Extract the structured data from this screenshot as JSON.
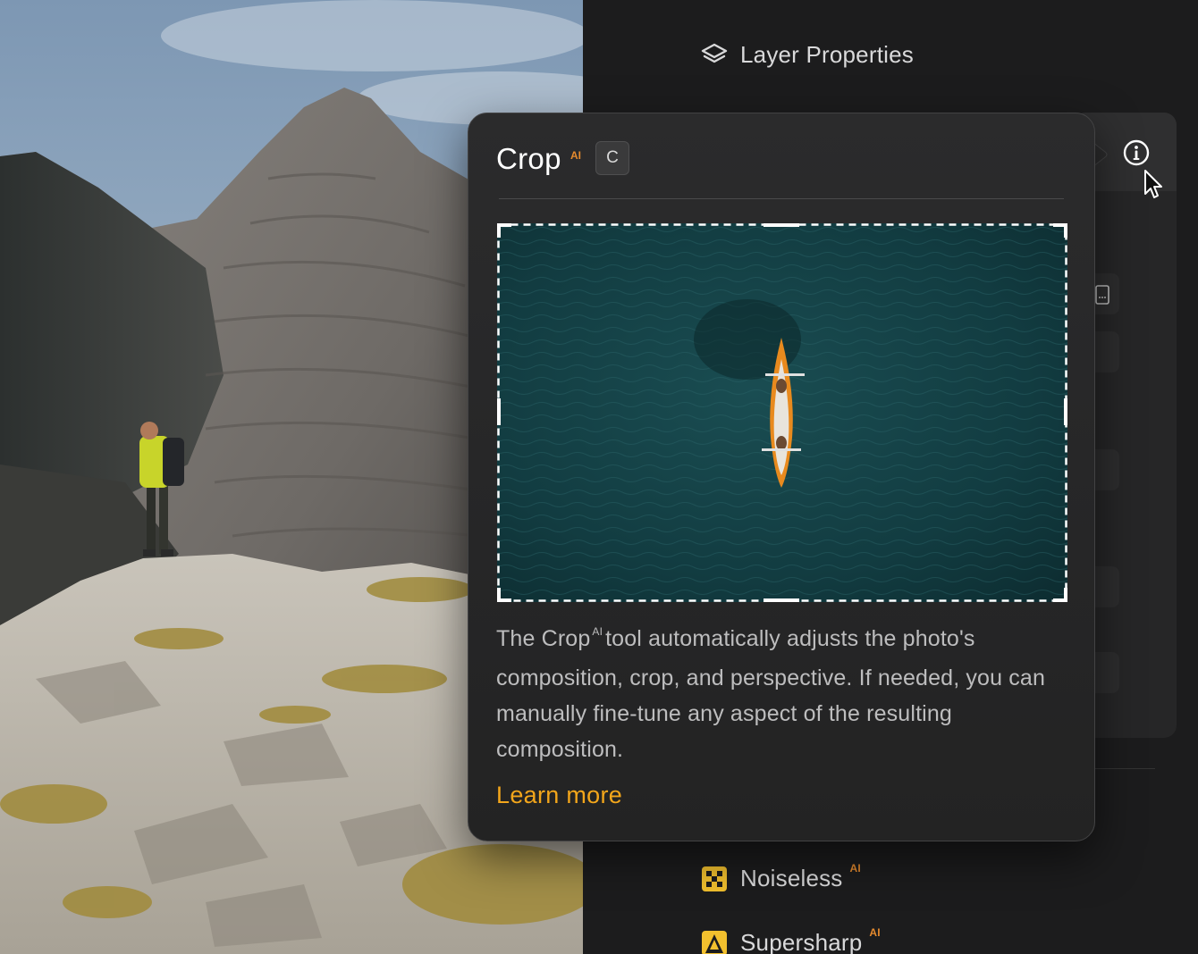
{
  "panel": {
    "layer_properties": {
      "label": "Layer Properties",
      "icon": "layers-icon"
    },
    "tools": [
      {
        "label": "Noiseless",
        "ai_badge": "AI",
        "icon": "noiseless-icon",
        "icon_color": "#f2c02e"
      },
      {
        "label": "Supersharp",
        "ai_badge": "AI",
        "icon": "supersharp-icon",
        "icon_color": "#f2c02e"
      }
    ],
    "info_icon": "info-icon"
  },
  "popover": {
    "title": "Crop",
    "ai_badge": "AI",
    "shortcut": "C",
    "description_pre": "The Crop",
    "description_ai": "AI",
    "description_post": "tool automatically adjusts the photo's composition, crop, and perspective. If needed, you can manually fine-tune any aspect of the resulting composition.",
    "learn_more": "Learn more"
  },
  "colors": {
    "accent": "#f3a61b",
    "ai_badge": "#e58a2e",
    "panel_bg": "#1c1c1d",
    "popover_bg": "#262627"
  }
}
